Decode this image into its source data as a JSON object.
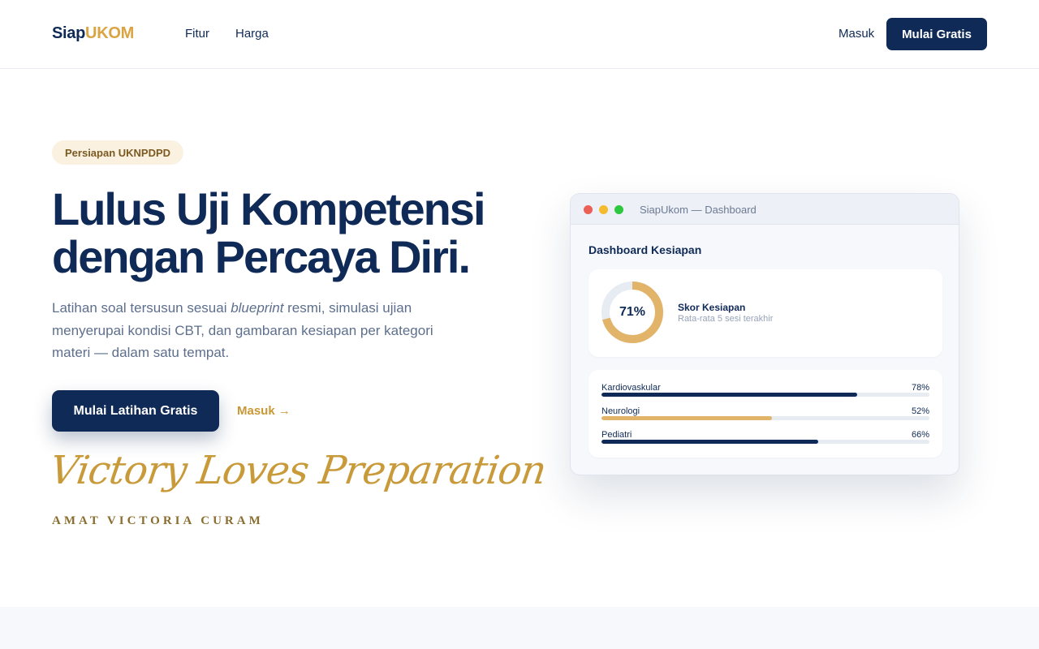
{
  "nav": {
    "logo_part1": "Siap",
    "logo_part2": "UKOM",
    "links": [
      "Fitur",
      "Harga"
    ],
    "login": "Masuk",
    "cta": "Mulai Gratis"
  },
  "hero": {
    "badge": "Persiapan UKNPDPD",
    "headline_line1": "Lulus Uji Kompetensi",
    "headline_line2": "dengan Percaya Diri.",
    "lead_before": "Latihan soal tersusun sesuai ",
    "lead_em": "blueprint",
    "lead_after": " resmi, simulasi ujian menyerupai kondisi CBT, dan gambaran kesiapan per kategori materi — dalam satu tempat.",
    "primary_button": "Mulai Latihan Gratis",
    "secondary_link": "Masuk",
    "secondary_arrow": "→",
    "script_motto": "Victory Loves Preparation",
    "latin_motto": "AMAT VICTORIA CURAM"
  },
  "dashboard": {
    "window_title": "SiapUkom — Dashboard",
    "heading": "Dashboard Kesiapan",
    "score": {
      "label": "71%",
      "value": 71,
      "title": "Skor Kesiapan",
      "subtitle": "Rata-rata 5 sesi terakhir"
    },
    "categories": [
      {
        "name": "Kardiovaskular",
        "label": "78%",
        "value": 78,
        "color": "#0f2a56"
      },
      {
        "name": "Neurologi",
        "label": "52%",
        "value": 52,
        "color": "#e2b46a"
      },
      {
        "name": "Pediatri",
        "label": "66%",
        "value": 66,
        "color": "#0f2a56"
      }
    ]
  },
  "colors": {
    "navy": "#0f2a56",
    "gold": "#d9a441",
    "ring_track": "#e7ebf2",
    "ring_fill": "#e2b46a",
    "dot_red": "#ec5f57",
    "dot_yellow": "#f4bb2f",
    "dot_green": "#2ec840"
  }
}
